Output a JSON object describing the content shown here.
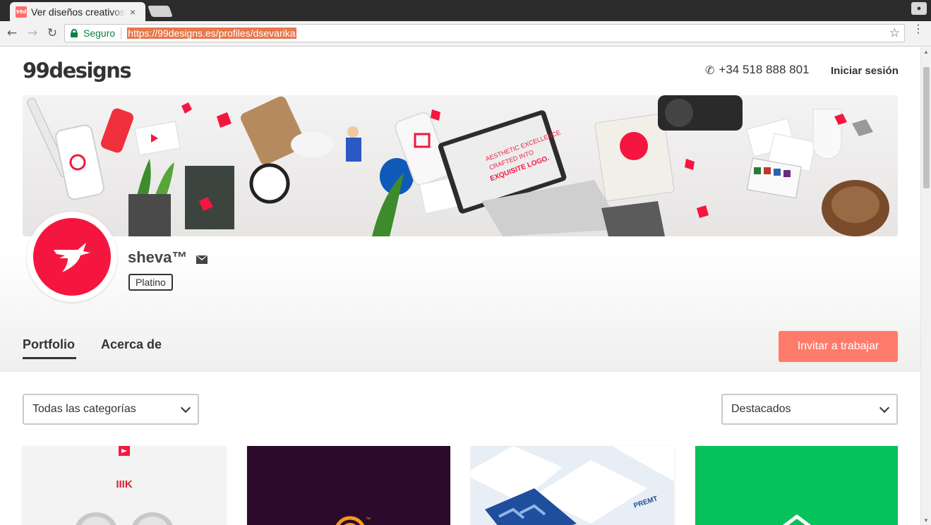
{
  "browser": {
    "tab_title": "Ver diseños creativos de sheva™",
    "tab_favicon_text": "99d",
    "close_glyph": "×",
    "secure_label": "Seguro",
    "url": "https://99designs.es/profiles/dsevarika",
    "icons": [
      "back-arrow-icon",
      "forward-arrow-icon",
      "reload-icon",
      "lock-icon",
      "star-icon",
      "menu-icon",
      "profile-icon"
    ]
  },
  "header": {
    "logo": "99designs",
    "phone": "+34 518 888 801",
    "login": "Iniciar sesión"
  },
  "banner": {
    "tagline_lines": [
      "AESTHETIC EXCELLENCE",
      "CRAFTED INTO",
      "EXQUISITE LOGO."
    ]
  },
  "profile": {
    "name": "sheva™",
    "level": "Platino"
  },
  "tabs": {
    "portfolio": "Portfolio",
    "about": "Acerca de"
  },
  "actions": {
    "invite": "Invitar a trabajar"
  },
  "filters": {
    "category_value": "Todas las categorías",
    "sort_value": "Destacados"
  },
  "portfolio_cards": [
    {
      "brand_text": "IIIK"
    },
    {
      "brand_text": ""
    },
    {
      "brand_text": "PREMT"
    },
    {
      "brand_text": ""
    }
  ],
  "colors": {
    "accent": "#fe7b6b",
    "brand_red": "#f5163f",
    "secure_green": "#0b8043",
    "card2_bg": "#2b0a2b",
    "card4_bg": "#07c25a"
  }
}
